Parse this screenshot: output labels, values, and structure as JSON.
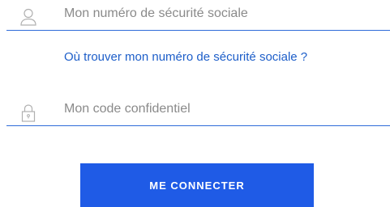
{
  "form": {
    "nir_field": {
      "placeholder": "Mon numéro de sécurité sociale",
      "icon": "user-icon",
      "value": ""
    },
    "help_link": {
      "label": "Où trouver mon numéro de sécurité sociale ?"
    },
    "code_field": {
      "placeholder": "Mon code confidentiel",
      "icon": "lock-icon",
      "value": ""
    },
    "submit": {
      "label": "ME CONNECTER"
    }
  },
  "colors": {
    "accent": "#1f5be6",
    "link": "#1d5ec9",
    "underline": "#2e6bd9",
    "placeholder": "#8a8a8a",
    "icon": "#b0b0b0"
  }
}
